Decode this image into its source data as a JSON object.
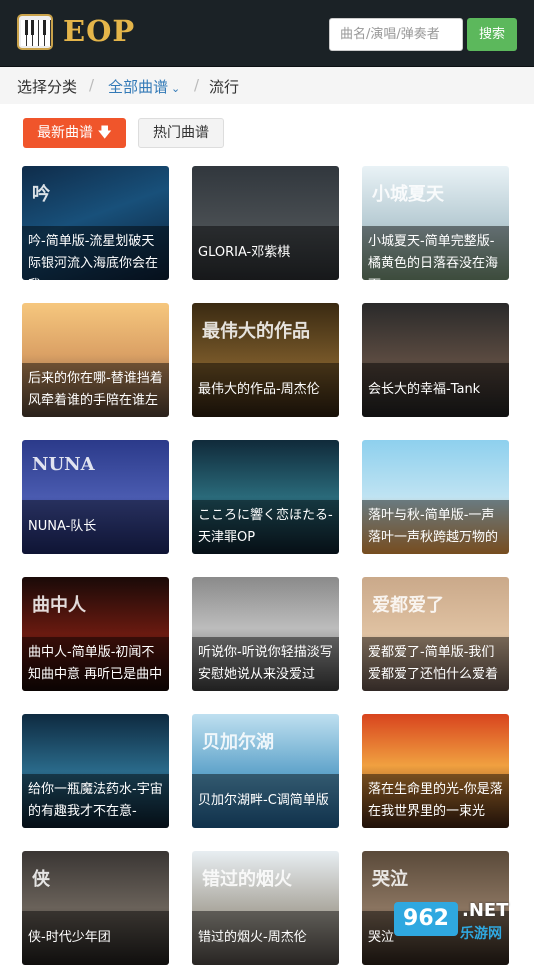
{
  "header": {
    "logo_text": "EOP",
    "search_placeholder": "曲名/演唱/弹奏者",
    "search_button": "搜索"
  },
  "breadcrumb": {
    "root": "选择分类",
    "sep": "/",
    "all": "全部曲谱",
    "current": "流行"
  },
  "sort": {
    "newest": "最新曲谱",
    "hot": "热门曲谱"
  },
  "cards": [
    {
      "text": "吟-简单版-流星划破天际银河流入海底你会在我",
      "bg": "linear-gradient(160deg,#0f2c4a,#18507a 45%,#0b1d33)",
      "one": false,
      "overlay": "吟"
    },
    {
      "text": "GLORIA-邓紫棋",
      "bg": "linear-gradient(180deg,#31373d,#4a4f53 55%,#2a2d30)",
      "one": true,
      "overlay": ""
    },
    {
      "text": "小城夏天-简单完整版-橘黄色的日落吞没在海面",
      "bg": "linear-gradient(180deg,#e9f2f6,#b8ccd4 50%,#6f8a6e)",
      "one": false,
      "overlay": "小城夏天"
    },
    {
      "text": "后来的你在哪-替谁挡着风牵着谁的手陪在谁左",
      "bg": "linear-gradient(180deg,#f6c77e,#dba165 45%,#4c3c31)",
      "one": false,
      "overlay": ""
    },
    {
      "text": "最伟大的作品-周杰伦",
      "bg": "linear-gradient(180deg,#3a2a12,#7a5a2a 55%,#2a1d0e)",
      "one": true,
      "overlay": "最伟大的作品"
    },
    {
      "text": "会长大的幸福-Tank",
      "bg": "linear-gradient(180deg,#2a2a2a,#5a4a40 50%,#1e1e1e)",
      "one": true,
      "overlay": ""
    },
    {
      "text": "NUNA-队长",
      "bg": "linear-gradient(180deg,#2b3a8a,#4a5bb0 50%,#1c2560)",
      "one": true,
      "overlay": "NUNA"
    },
    {
      "text": "こころに響く恋ほたる-天津罪OP",
      "bg": "linear-gradient(180deg,#102a3a,#2a6a7a 50%,#0c1c28)",
      "one": false,
      "overlay": ""
    },
    {
      "text": "落叶与秋-简单版-一声落叶一声秋跨越万物的",
      "bg": "linear-gradient(180deg,#8ed0ee,#bfe3f2 50%,#d88c3a)",
      "one": false,
      "overlay": ""
    },
    {
      "text": "曲中人-简单版-初闻不知曲中意 再听已是曲中",
      "bg": "linear-gradient(180deg,#1a0a08,#6a1a10 50%,#140806)",
      "one": false,
      "overlay": "曲中人"
    },
    {
      "text": "听说你-听说你轻描淡写安慰她说从来没爱过",
      "bg": "linear-gradient(180deg,#8a8a8a,#bdbdbd 45%,#3a3a3a)",
      "one": false,
      "overlay": ""
    },
    {
      "text": "爱都爱了-简单版-我们爱都爱了还怕什么爱着",
      "bg": "linear-gradient(180deg,#caa98a,#e0c2a2 50%,#5a4a44)",
      "one": false,
      "overlay": "爱都爱了"
    },
    {
      "text": "给你一瓶魔法药水-宇宙的有趣我才不在意-",
      "bg": "linear-gradient(180deg,#0e2a40,#2a6a8a 50%,#0a1a28)",
      "one": false,
      "overlay": ""
    },
    {
      "text": "贝加尔湖畔-C调简单版",
      "bg": "linear-gradient(180deg,#bfe0f0,#5aa0c8 55%,#1e5a8a)",
      "one": true,
      "overlay": "贝加尔湖"
    },
    {
      "text": "落在生命里的光-你是落在我世界里的一束光",
      "bg": "linear-gradient(180deg,#d8441e,#f0a040 45%,#3a1e10)",
      "one": false,
      "overlay": ""
    },
    {
      "text": "侠-时代少年团",
      "bg": "linear-gradient(180deg,#3a3634,#6a625a 50%,#1e1c1a)",
      "one": true,
      "overlay": "侠"
    },
    {
      "text": "错过的烟火-周杰伦",
      "bg": "linear-gradient(180deg,#e8eef2,#a8a49a 55%,#4a4440)",
      "one": true,
      "overlay": "错过的烟火"
    },
    {
      "text": "哭泣",
      "bg": "linear-gradient(180deg,#5a4a3a,#8a7460 50%,#2a2018)",
      "one": true,
      "overlay": "哭泣"
    }
  ],
  "watermark": {
    "badge": "962",
    "site": ".NET",
    "name": "乐游网"
  }
}
